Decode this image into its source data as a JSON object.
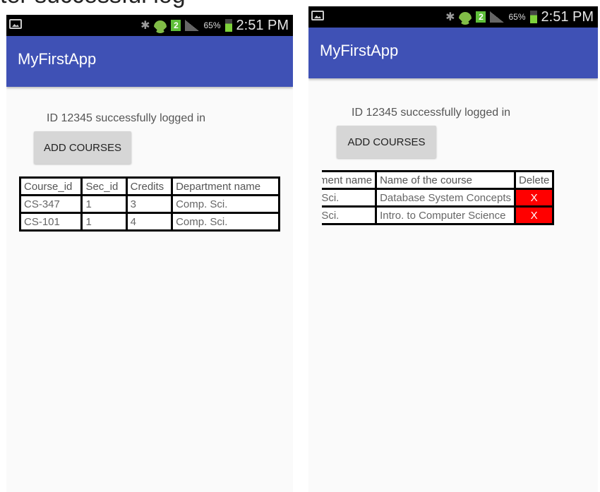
{
  "caption_fragment": "ter successful log",
  "status_bar": {
    "time": "2:51 PM",
    "battery": "65%",
    "sim": "2",
    "icons": [
      "image-notification-icon",
      "bluetooth-icon",
      "wifi-icon",
      "sim-icon",
      "signal-icon",
      "battery-icon"
    ]
  },
  "app": {
    "title": "MyFirstApp",
    "bar_color": "#3f51b5"
  },
  "login_message": "ID 12345 successfully logged in",
  "add_courses_label": "ADD COURSES",
  "left_table": {
    "headers": [
      "Course_id",
      "Sec_id",
      "Credits",
      "Department name"
    ],
    "rows": [
      [
        "CS-347",
        "1",
        "3",
        "Comp. Sci."
      ],
      [
        "CS-101",
        "1",
        "4",
        "Comp. Sci."
      ]
    ]
  },
  "right_table": {
    "headers": [
      "Department name",
      "Name of the course",
      "Delete"
    ],
    "rows": [
      [
        "Comp. Sci.",
        "Database System Concepts",
        "X"
      ],
      [
        "Comp. Sci.",
        "Intro. to Computer Science",
        "X"
      ]
    ],
    "delete_color": "#ff0000"
  }
}
